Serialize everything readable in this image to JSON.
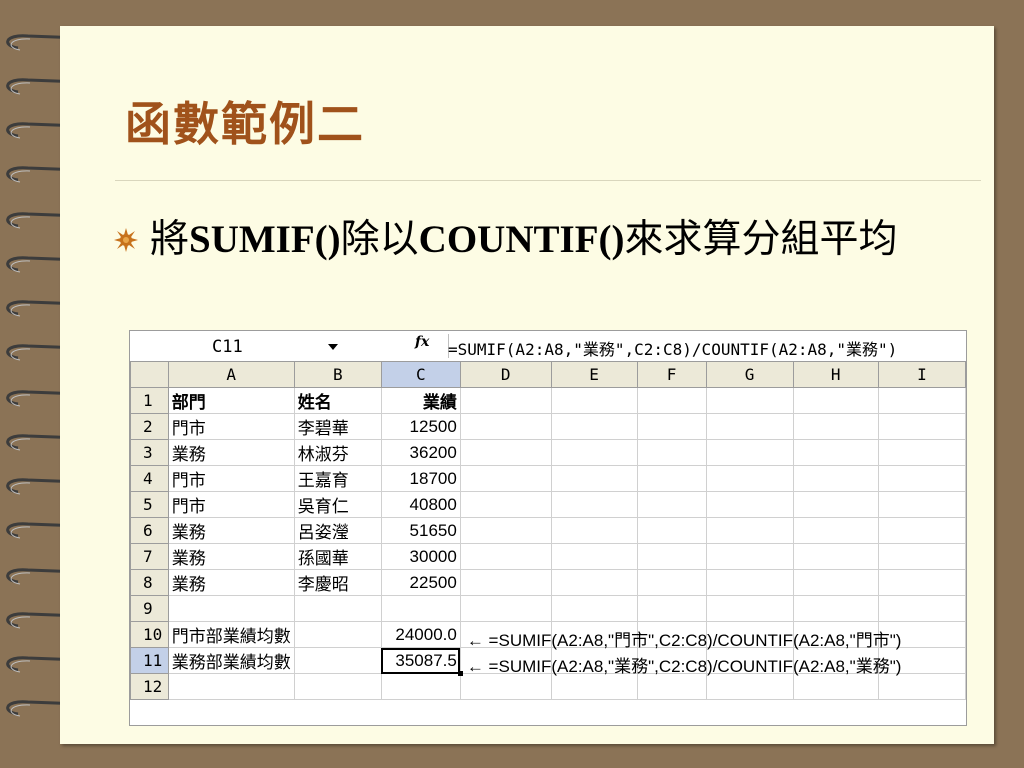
{
  "slide": {
    "title": "函數範例二",
    "bullet": {
      "prefix": "將",
      "func1": "SUMIF()",
      "mid": "除以",
      "func2": "COUNTIF()",
      "suffix": "來求算分組平均"
    }
  },
  "spreadsheet": {
    "name_box": "C11",
    "formula_icon": "fx",
    "formula": "=SUMIF(A2:A8,\"業務\",C2:C8)/COUNTIF(A2:A8,\"業務\")",
    "columns": [
      "A",
      "B",
      "C",
      "D",
      "E",
      "F",
      "G",
      "H",
      "I"
    ],
    "selected_column": "C",
    "selected_row": "11",
    "rows": [
      {
        "n": "1",
        "a": "部門",
        "b": "姓名",
        "c": "業績",
        "note": ""
      },
      {
        "n": "2",
        "a": "門市",
        "b": "李碧華",
        "c": "12500",
        "note": ""
      },
      {
        "n": "3",
        "a": "業務",
        "b": "林淑芬",
        "c": "36200",
        "note": ""
      },
      {
        "n": "4",
        "a": "門市",
        "b": "王嘉育",
        "c": "18700",
        "note": ""
      },
      {
        "n": "5",
        "a": "門市",
        "b": "吳育仁",
        "c": "40800",
        "note": ""
      },
      {
        "n": "6",
        "a": "業務",
        "b": "呂姿瀅",
        "c": "51650",
        "note": ""
      },
      {
        "n": "7",
        "a": "業務",
        "b": "孫國華",
        "c": "30000",
        "note": ""
      },
      {
        "n": "8",
        "a": "業務",
        "b": "李慶昭",
        "c": "22500",
        "note": ""
      },
      {
        "n": "9",
        "a": "",
        "b": "",
        "c": "",
        "note": ""
      },
      {
        "n": "10",
        "a": "門市部業績均數",
        "b": "",
        "c": "24000.0",
        "note": "← =SUMIF(A2:A8,\"門市\",C2:C8)/COUNTIF(A2:A8,\"門市\")"
      },
      {
        "n": "11",
        "a": "業務部業績均數",
        "b": "",
        "c": "35087.5",
        "note": "← =SUMIF(A2:A8,\"業務\",C2:C8)/COUNTIF(A2:A8,\"業務\")"
      },
      {
        "n": "12",
        "a": "",
        "b": "",
        "c": "",
        "note": ""
      }
    ]
  },
  "colors": {
    "background": "#8b7356",
    "slide": "#fdfce4",
    "title": "#a0521b",
    "header_fill": "#ece9d8",
    "header_selected": "#c3d0e8"
  }
}
